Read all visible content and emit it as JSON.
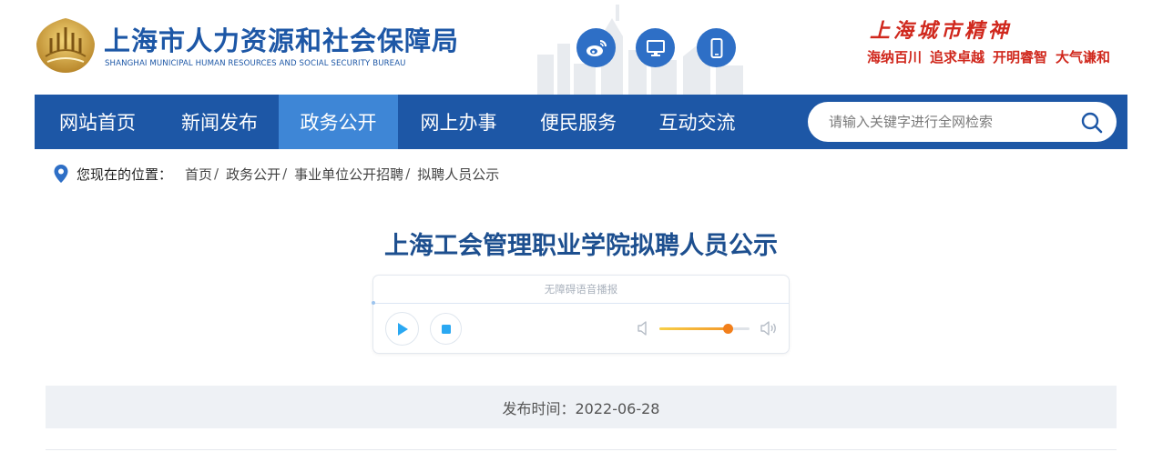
{
  "header": {
    "site_title": "上海市人力资源和社会保障局",
    "site_subtitle": "SHANGHAI MUNICIPAL HUMAN RESOURCES AND SOCIAL SECURITY BUREAU",
    "icons": [
      "weibo-icon",
      "desktop-icon",
      "mobile-icon"
    ],
    "spirit_title": "上海城市精神",
    "spirit_words": [
      "海纳百川",
      "追求卓越",
      "开明睿智",
      "大气谦和"
    ]
  },
  "nav": {
    "items": [
      {
        "label": "网站首页",
        "active": false
      },
      {
        "label": "新闻发布",
        "active": false
      },
      {
        "label": "政务公开",
        "active": true
      },
      {
        "label": "网上办事",
        "active": false
      },
      {
        "label": "便民服务",
        "active": false
      },
      {
        "label": "互动交流",
        "active": false
      }
    ],
    "search_placeholder": "请输入关键字进行全网检索"
  },
  "breadcrumb": {
    "label": "您现在的位置：",
    "items": [
      "首页",
      "政务公开",
      "事业单位公开招聘",
      "拟聘人员公示"
    ],
    "separator": "/"
  },
  "article": {
    "title": "上海工会管理职业学院拟聘人员公示",
    "player_label": "无障碍语音播报",
    "volume_level": 0.76,
    "publish_date": "发布时间：2022-06-28"
  },
  "colors": {
    "brand_blue": "#1d57a6",
    "nav_active": "#3e86d6",
    "spirit_red": "#d0281d",
    "title_blue": "#1d4f8f",
    "play_blue": "#2aa8f2",
    "volume_orange": "#f27f1b"
  }
}
